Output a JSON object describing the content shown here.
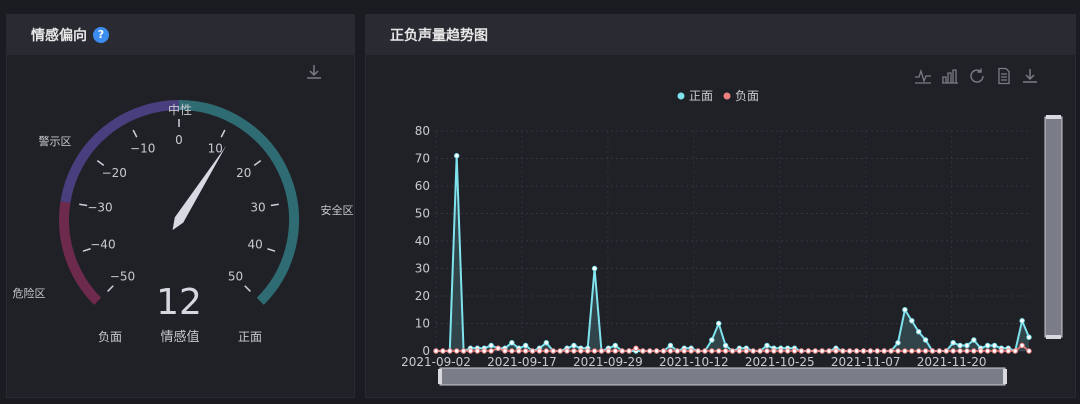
{
  "sentiment_panel": {
    "title": "情感偏向",
    "help_icon": "?",
    "zones": {
      "warning": "警示区",
      "danger": "危险区",
      "safe": "安全区",
      "neutral": "中性"
    },
    "ends": {
      "negative": "负面",
      "positive": "正面"
    },
    "value": 12,
    "value_text": "12",
    "value_label": "情感值"
  },
  "trend_panel": {
    "title": "正负声量趋势图"
  },
  "chart_data": [
    {
      "type": "gauge",
      "min": -50,
      "max": 50,
      "value": 12,
      "tick_labels": [
        "-50",
        "-40",
        "-30",
        "-20",
        "-10",
        "0",
        "10",
        "20",
        "30",
        "40",
        "50"
      ],
      "bands": [
        {
          "from": -50,
          "to": -30,
          "label": "危险区",
          "color": "#6e2a4c"
        },
        {
          "from": -30,
          "to": 0,
          "label": "警示区",
          "color": "#4a3f7e"
        },
        {
          "from": 0,
          "to": 50,
          "label": "安全区",
          "color": "#2f6b72"
        }
      ],
      "center_label": "中性",
      "min_label": "负面",
      "max_label": "正面"
    },
    {
      "type": "line",
      "legend": [
        "正面",
        "负面"
      ],
      "legend_position": "top-center",
      "xlabels": [
        "2021-09-02",
        "2021-09-17",
        "2021-09-29",
        "2021-10-12",
        "2021-10-25",
        "2021-11-07",
        "2021-11-20"
      ],
      "ylim": [
        0,
        80
      ],
      "yticks": [
        0,
        10,
        20,
        30,
        40,
        50,
        60,
        70,
        80
      ],
      "grid": true,
      "series": [
        {
          "name": "正面",
          "color": "#7fe3ee",
          "values": [
            0,
            0,
            0,
            71,
            0,
            1,
            1,
            1,
            2,
            1,
            1,
            3,
            1,
            2,
            0,
            1,
            3,
            0,
            0,
            1,
            2,
            1,
            1,
            30,
            0,
            1,
            2,
            0,
            0,
            0,
            0,
            0,
            0,
            0,
            2,
            0,
            1,
            1,
            0,
            0,
            4,
            10,
            2,
            0,
            1,
            1,
            0,
            0,
            2,
            1,
            1,
            1,
            1,
            0,
            0,
            0,
            0,
            0,
            1,
            0,
            0,
            0,
            0,
            0,
            0,
            0,
            0,
            3,
            15,
            11,
            7,
            4,
            0,
            0,
            0,
            3,
            2,
            2,
            4,
            1,
            2,
            2,
            1,
            1,
            0,
            11,
            5
          ]
        },
        {
          "name": "负面",
          "color": "#f07f7f",
          "values": [
            0,
            0,
            0,
            0,
            0,
            0,
            0,
            0,
            0,
            1,
            0,
            0,
            0,
            0,
            0,
            0,
            0,
            0,
            0,
            0,
            0,
            0,
            0,
            0,
            0,
            0,
            0,
            0,
            0,
            1,
            0,
            0,
            0,
            0,
            0,
            0,
            0,
            0,
            0,
            0,
            0,
            0,
            0,
            0,
            0,
            0,
            0,
            0,
            0,
            0,
            0,
            0,
            0,
            0,
            0,
            0,
            0,
            0,
            0,
            0,
            0,
            0,
            0,
            0,
            0,
            0,
            0,
            0,
            0,
            0,
            0,
            0,
            0,
            0,
            0,
            0,
            0,
            0,
            0,
            0,
            0,
            0,
            0,
            0,
            0,
            2,
            0
          ]
        }
      ]
    }
  ],
  "colors": {
    "positive": "#7fe3ee",
    "negative": "#f07f7f",
    "panel": "#202127",
    "header": "#2a2b32"
  }
}
